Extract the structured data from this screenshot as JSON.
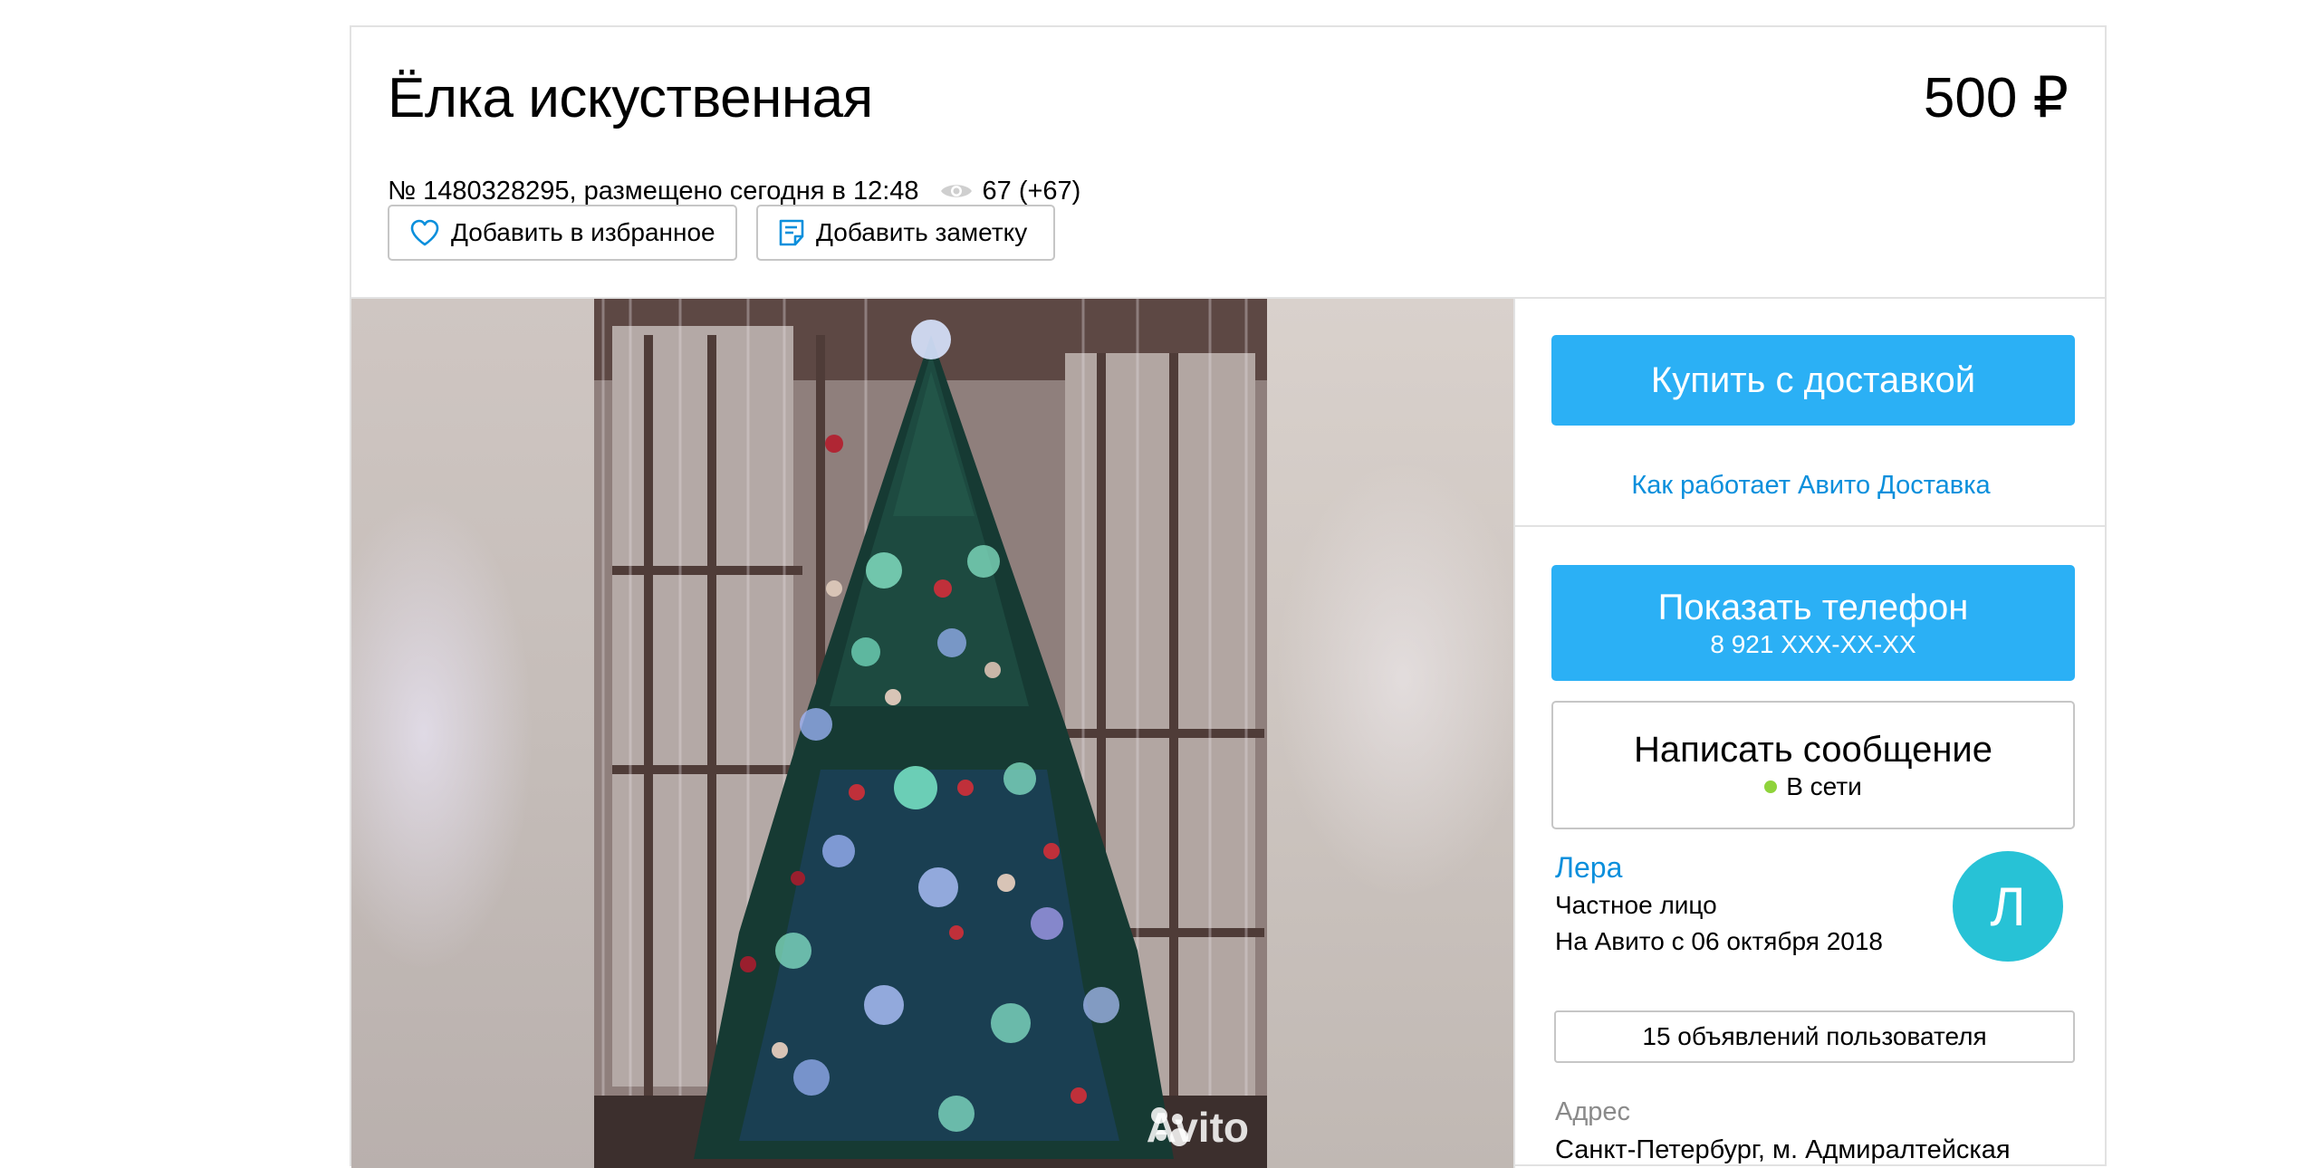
{
  "listing": {
    "title": "Ёлка искуственная",
    "price": "500 ₽",
    "meta_text": "№ 1480328295, размещено сегодня в 12:48",
    "views": "67 (+67)"
  },
  "actions": {
    "favorite_label": "Добавить в избранное",
    "note_label": "Добавить заметку"
  },
  "gallery": {
    "watermark": "Avito"
  },
  "sidebar": {
    "buy_label": "Купить с доставкой",
    "delivery_link": "Как работает Авито Доставка",
    "phone_label": "Показать телефон",
    "phone_number": "8 921 XXX-XX-XX",
    "message_label": "Написать сообщение",
    "online_status": "В сети",
    "seller": {
      "name": "Лера",
      "type": "Частное лицо",
      "since": "На Авито с 06 октября 2018",
      "avatar_letter": "Л"
    },
    "listings_button": "15 объявлений пользователя",
    "address_label": "Адрес",
    "address_value": "Санкт-Петербург, м. Адмиралтейская"
  },
  "colors": {
    "primary_button": "#2bb0f5",
    "link": "#0a8fdc",
    "avatar": "#27c2d6",
    "online_dot": "#8fd33b"
  },
  "icons": [
    "eye-icon",
    "heart-icon",
    "note-icon",
    "online-dot-icon",
    "avito-logo-icon"
  ]
}
